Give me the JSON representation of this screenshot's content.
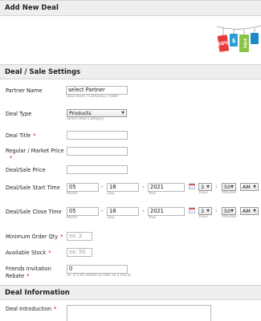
{
  "header": {
    "title": "Add New Deal"
  },
  "sections": {
    "deal_sale_settings": "Deal / Sale Settings",
    "deal_information": "Deal Information"
  },
  "banner_tags": [
    {
      "text": "50%",
      "color": "#e63c3c"
    },
    {
      "text": "$",
      "color": "#2a9fd6"
    },
    {
      "text": "SALE",
      "color": "#8bc34a"
    },
    {
      "text": "",
      "color": "#1e88c9"
    }
  ],
  "form": {
    "partner": {
      "label": "Partner Name",
      "value": "select Partner",
      "hint": "Deal Store / Company / Hotel"
    },
    "deal_type": {
      "label": "Deal Type",
      "value": "Products",
      "hint": "Select Deal Category"
    },
    "deal_title": {
      "label": "Deal Title"
    },
    "regular_price": {
      "label": "Regular / Market Price"
    },
    "sale_price": {
      "label": "Deal/Sale Price"
    },
    "start_time": {
      "label": "Deal/Sale Start Time",
      "month": "05",
      "day": "18",
      "year": "2021",
      "hour": "3",
      "minute": "50",
      "ampm": "AM",
      "month_hint": "Month",
      "day_hint": "Day",
      "year_hint": "Year",
      "hour_hint": "Hour",
      "minute_hint": "Minutes"
    },
    "close_time": {
      "label": "Deal/Sale Close Time",
      "month": "05",
      "day": "18",
      "year": "2021",
      "hour": "3",
      "minute": "50",
      "ampm": "AM",
      "month_hint": "Month",
      "day_hint": "Day",
      "year_hint": "Year",
      "hour_hint": "Hour",
      "minute_hint": "Minutes"
    },
    "min_order": {
      "label": "Minimum Order Qty",
      "placeholder": "ex: 2"
    },
    "stock": {
      "label": "Available Stock",
      "placeholder": "ex: 50"
    },
    "friends_rebate": {
      "label_line1": "Friends Invitation",
      "label_line2": "Rebate",
      "value": "0",
      "hint": "ex: $ 5.00 rebate to refer to a friend"
    },
    "deal_intro": {
      "label": "Deal Introduction"
    }
  },
  "colors": {
    "required": "#cc0000",
    "header_bg": "#eeeeee"
  }
}
